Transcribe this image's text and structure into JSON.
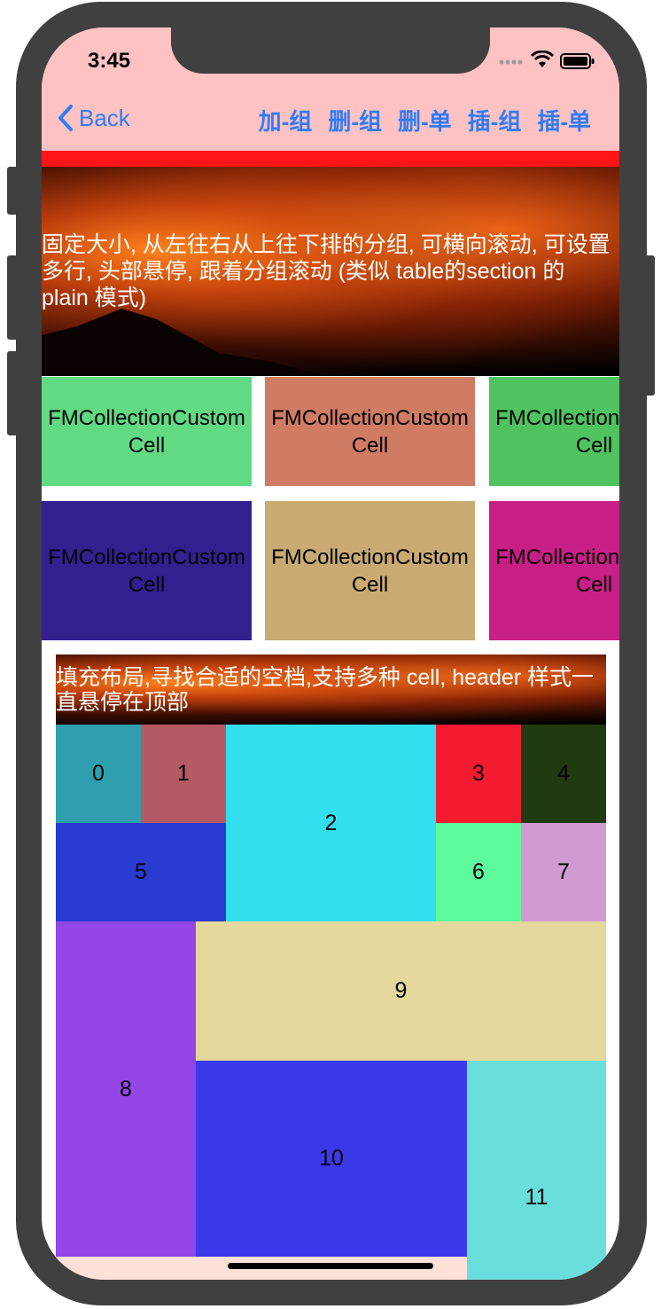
{
  "status": {
    "time": "3:45",
    "signal_icon": "signal-dots-icon",
    "wifi_icon": "wifi-icon",
    "battery_icon": "battery-icon"
  },
  "nav": {
    "back_label": "Back",
    "buttons": [
      "加-组",
      "删-组",
      "删-单",
      "插-组",
      "插-单"
    ]
  },
  "section1": {
    "header_text": "固定大小, 从左往右从上往下排的分组, 可横向滚动, 可设置多行, 头部悬停, 跟着分组滚动 (类似 table的section 的 plain 模式)",
    "cells": [
      {
        "label": "FMCollectionCustomCell",
        "color": "#62d983"
      },
      {
        "label": "FMCollectionCustomCell",
        "color": "#d07c65"
      },
      {
        "label": "FMCollectionCustomCell",
        "color": "#4fc360"
      },
      {
        "label": "FMCollectionCustomCell",
        "color": "#341f8f"
      },
      {
        "label": "FMCollectionCustomCell",
        "color": "#c8aa72"
      },
      {
        "label": "FMCollectionCustomCell",
        "color": "#c81f86"
      }
    ]
  },
  "section2": {
    "header_text": "填充布局,寻找合适的空档,支持多种 cell, header 样式一直悬停在顶部",
    "tiles": [
      {
        "label": "0",
        "color": "#2f9fb0"
      },
      {
        "label": "1",
        "color": "#b45a65"
      },
      {
        "label": "2",
        "color": "#33dfee"
      },
      {
        "label": "3",
        "color": "#f41b31"
      },
      {
        "label": "4",
        "color": "#223a0f"
      },
      {
        "label": "5",
        "color": "#2a3bd2"
      },
      {
        "label": "6",
        "color": "#5dfb9b"
      },
      {
        "label": "7",
        "color": "#cf9bd1"
      },
      {
        "label": "8",
        "color": "#9446e7"
      },
      {
        "label": "9",
        "color": "#e5d89d"
      },
      {
        "label": "10",
        "color": "#3a3aeb"
      },
      {
        "label": "11",
        "color": "#6adedd"
      }
    ]
  }
}
